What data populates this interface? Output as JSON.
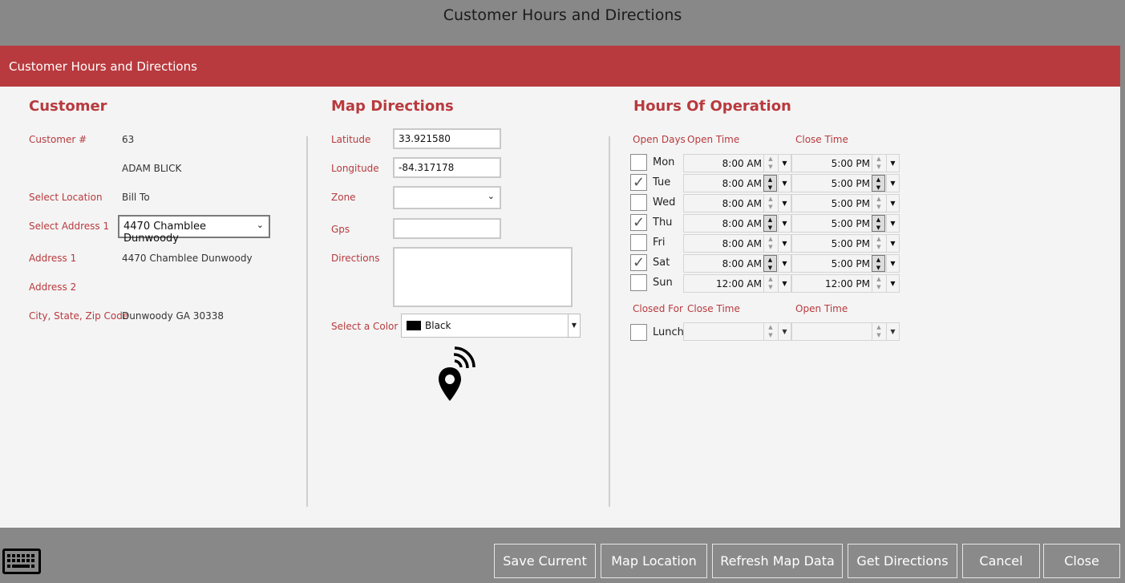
{
  "window": {
    "title": "Customer Hours and Directions"
  },
  "panel": {
    "header": "Customer Hours and Directions"
  },
  "customer": {
    "section_title": "Customer",
    "customer_no_label": "Customer #",
    "customer_no": "63",
    "name": "ADAM BLICK",
    "select_location_label": "Select Location",
    "select_location": "Bill To",
    "select_address_label": "Select Address 1",
    "select_address": "4470 Chamblee Dunwoody",
    "address1_label": "Address 1",
    "address1": "4470 Chamblee Dunwoody",
    "address2_label": "Address 2",
    "address2": "",
    "city_label": "City, State, Zip Code",
    "city": "Dunwoody GA 30338"
  },
  "map": {
    "section_title": "Map Directions",
    "latitude_label": "Latitude",
    "latitude": "33.921580",
    "longitude_label": "Longitude",
    "longitude": "-84.317178",
    "zone_label": "Zone",
    "zone": "",
    "gps_label": "Gps",
    "gps": "",
    "directions_label": "Directions",
    "directions": "",
    "color_label": "Select a Color",
    "color": "Black",
    "color_hex": "#000000",
    "icon": "location-signal-icon"
  },
  "hours": {
    "section_title": "Hours Of Operation",
    "col_days": "Open Days",
    "col_open": "Open Time",
    "col_close": "Close Time",
    "days": [
      {
        "name": "Mon",
        "checked": false,
        "open": "8:00 AM",
        "close": "5:00 PM"
      },
      {
        "name": "Tue",
        "checked": true,
        "open": "8:00 AM",
        "close": "5:00 PM"
      },
      {
        "name": "Wed",
        "checked": false,
        "open": "8:00 AM",
        "close": "5:00 PM"
      },
      {
        "name": "Thu",
        "checked": true,
        "open": "8:00 AM",
        "close": "5:00 PM"
      },
      {
        "name": "Fri",
        "checked": false,
        "open": "8:00 AM",
        "close": "5:00 PM"
      },
      {
        "name": "Sat",
        "checked": true,
        "open": "8:00 AM",
        "close": "5:00 PM"
      },
      {
        "name": "Sun",
        "checked": false,
        "open": "12:00 AM",
        "close": "12:00 PM"
      }
    ],
    "closed_for_label": "Closed For",
    "closed_close_label": "Close Time",
    "closed_open_label": "Open Time",
    "lunch_label": "Lunch",
    "lunch_checked": false
  },
  "buttons": {
    "save": "Save Current",
    "map_location": "Map Location",
    "refresh": "Refresh Map Data",
    "directions": "Get Directions",
    "cancel": "Cancel",
    "close": "Close"
  },
  "colors": {
    "accent": "#b83a3e",
    "panel_bg": "#f4f4f4",
    "backdrop": "#888888"
  }
}
